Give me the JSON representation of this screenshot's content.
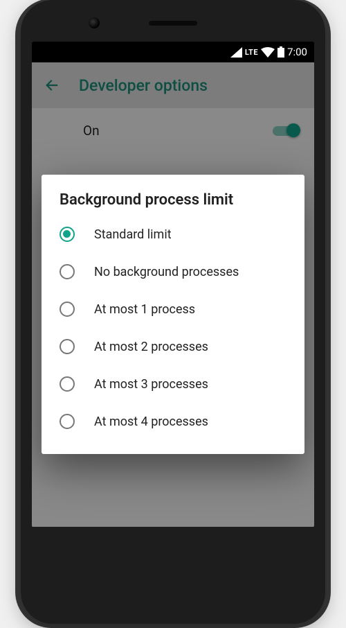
{
  "status": {
    "lte": "LTE",
    "time": "7:00"
  },
  "appbar": {
    "title": "Developer options"
  },
  "toggle": {
    "label": "On",
    "state": true
  },
  "dialog": {
    "title": "Background process limit",
    "selected_index": 0,
    "options": [
      {
        "label": "Standard limit"
      },
      {
        "label": "No background processes"
      },
      {
        "label": "At most 1 process"
      },
      {
        "label": "At most 2 processes"
      },
      {
        "label": "At most 3 processes"
      },
      {
        "label": "At most 4 processes"
      }
    ]
  },
  "colors": {
    "accent": "#12a38a"
  }
}
